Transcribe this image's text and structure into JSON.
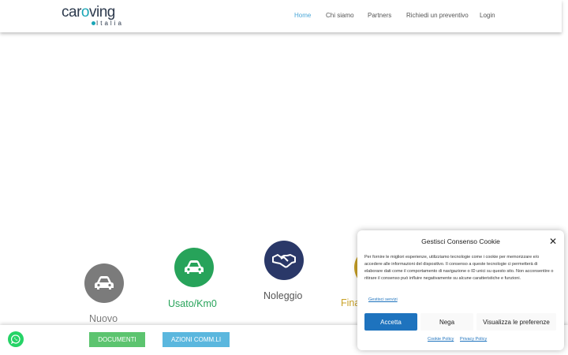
{
  "header": {
    "logo_main_left": "car",
    "logo_main_o": "o",
    "logo_main_right": "ving",
    "logo_sub": "Italia",
    "nav": [
      "Home",
      "Chi siamo",
      "Partners",
      "Richiedi un preventivo",
      "Login"
    ],
    "active_nav": "Home"
  },
  "services": [
    {
      "label": "Nuovo",
      "color": "#7b7b7b",
      "icon": "car-icon"
    },
    {
      "label": "Usato/Km0",
      "color": "#27a35a",
      "icon": "car-icon"
    },
    {
      "label": "Noleggio",
      "color": "#2a3868",
      "icon": "handshake-icon"
    },
    {
      "label": "Fina",
      "color": "#c9a227",
      "icon": "finance-icon"
    }
  ],
  "footer": {
    "documents_label": "DOCUMENTI",
    "actions_label": "AZIONI COMM.LI",
    "whatsapp_icon": "whatsapp-icon"
  },
  "cookie": {
    "title": "Gestisci Consenso Cookie",
    "text": "Per fornire le migliori esperienze, utilizziamo tecnologie come i cookie per memorizzare e/o accedere alle informazioni del dispositivo. Il consenso a queste tecnologie ci permetterà di elaborare dati come il comportamento di navigazione o ID unici su questo sito. Non acconsentire o ritirare il consenso può influire negativamente su alcune caratteristiche e funzioni.",
    "manage_link": "Gestisci servizi",
    "accept": "Accetta",
    "deny": "Nega",
    "prefs": "Visualizza le preferenze",
    "cookie_policy": "Cookie Policy",
    "privacy_policy": "Privacy Policy"
  }
}
